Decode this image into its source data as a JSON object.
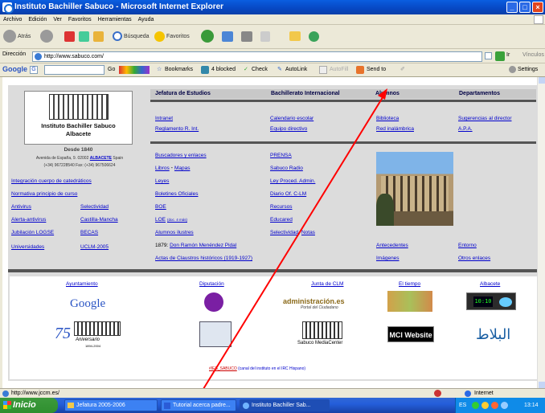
{
  "window": {
    "title": "Instituto Bachiller Sabuco - Microsoft Internet Explorer"
  },
  "menu": [
    "Archivo",
    "Edición",
    "Ver",
    "Favoritos",
    "Herramientas",
    "Ayuda"
  ],
  "toolbar": {
    "back": "Atrás",
    "search": "Búsqueda",
    "favorites": "Favoritos"
  },
  "address": {
    "label": "Dirección",
    "url": "http://www.sabuco.com/",
    "go": "Ir",
    "links": "Vínculos"
  },
  "googlebar": {
    "logo": "Google",
    "go": "Go",
    "bookmarks": "Bookmarks",
    "blocked": "4 blocked",
    "check": "Check",
    "autolink": "AutoLink",
    "autofill": "AutoFill",
    "sendto": "Send to",
    "settings": "Settings"
  },
  "site": {
    "school_name": "Instituto Bachiller Sabuco",
    "city": "Albacete",
    "since": "Desde 1840",
    "address": "Avenida de España, 9. 02002",
    "address_link": "ALBACETE",
    "address_country": "Spain",
    "phone": "(+34) 967228540  Fax: (+34) 967506624",
    "nav": [
      "Jefatura de Estudios",
      "Bachillerato Internacional",
      "Alumnos",
      "Departamentos"
    ],
    "row1": [
      [
        "Intranet",
        "Calendario escolar",
        "Biblioteca",
        "Sugerencias al director"
      ],
      [
        "Reglamento R. Int.",
        "Equipo directivo",
        "Red inalámbrica",
        "A.P.A."
      ]
    ],
    "left_links": [
      "Integración cuerpo de catedráticos",
      "Normativa principio de curso"
    ],
    "left_pairs": [
      [
        "Antivirus",
        "Selectividad"
      ],
      [
        "Alerta-antivirus",
        "Castilla-Mancha"
      ],
      [
        "Jubilación LOGSE",
        "BECAS"
      ],
      [
        "Universidades",
        "UCLM-2005"
      ]
    ],
    "col1": [
      "Buscadores y enlaces",
      "Libros",
      "Leyes",
      "Boletines Oficiales",
      "BOE",
      "LOE",
      "Alumnos ilustres"
    ],
    "col1_extra": {
      "mapas": "Mapas",
      "loe_small": "(doc. 4 más)",
      "year": "1879:",
      "pidal": "Don Ramón Menéndez Pidal",
      "actas": "Actas de Claustros históricos (1919-1927)"
    },
    "col2": [
      "PRENSA",
      "Sabuco Radio",
      "Ley Proced. Admin.",
      "Diario Of. C-LM",
      "Recursos",
      "Educared",
      "Selectividad"
    ],
    "col2_extra": {
      "notas": "Notas"
    },
    "col3": [
      "Antecedentes",
      "Imágenes"
    ],
    "col4": [
      "Entorno",
      "Otros enlaces"
    ],
    "banner_links": [
      "Ayuntamiento",
      "Diputación",
      "Junta de CLM",
      "El tiempo",
      "Albacete"
    ],
    "banners": {
      "google": "Google",
      "portal": "administración.es",
      "portal_sub": "Portal del Ciudadano",
      "mci": "MCI Website",
      "clock": "10:10",
      "aniv": "Aniversario",
      "aniv_years": "1894-2004",
      "media": "Sabuco MediaCenter",
      "arabic": "البلاط"
    },
    "irc_note": "(canal del instituto en el IRC Hispano)",
    "irc_link": "#IES_SABUCO"
  },
  "status": {
    "text": "http://www.jccm.es/",
    "zone": "Internet"
  },
  "taskbar": {
    "start": "Inicio",
    "tasks": [
      "Jefatura 2005-2006",
      "Tutorial acerca padre...",
      "Instituto Bachiller Sab..."
    ],
    "tray_lang": "ES",
    "clock": "13:14"
  },
  "colors": {
    "title": "#0747c2",
    "link": "#0000cc",
    "arrow": "#ff0000",
    "taskbar": "#245edb"
  }
}
